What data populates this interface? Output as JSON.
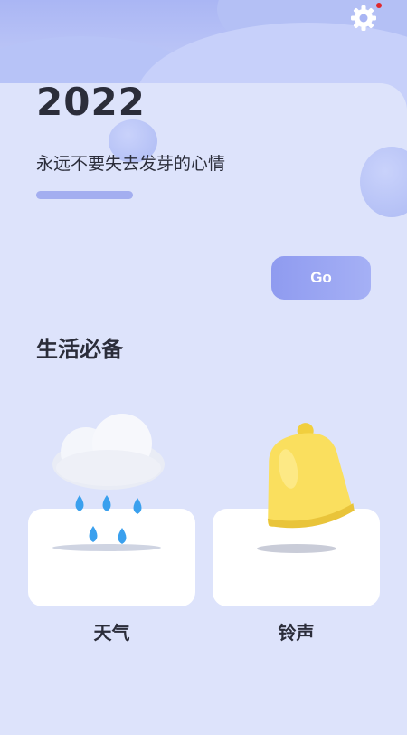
{
  "header": {
    "settings_icon": "gear-icon",
    "notification_dot_color": "#e0282e"
  },
  "hero": {
    "year": "2022",
    "subtitle": "永远不要失去发芽的心情",
    "go_label": "Go"
  },
  "section": {
    "title": "生活必备",
    "items": [
      {
        "label": "天气",
        "icon": "rain-cloud-icon"
      },
      {
        "label": "铃声",
        "icon": "bell-icon"
      }
    ]
  },
  "colors": {
    "background": "#dfe5fb",
    "accent": "#9aa5f2",
    "text": "#2b2d3a"
  }
}
